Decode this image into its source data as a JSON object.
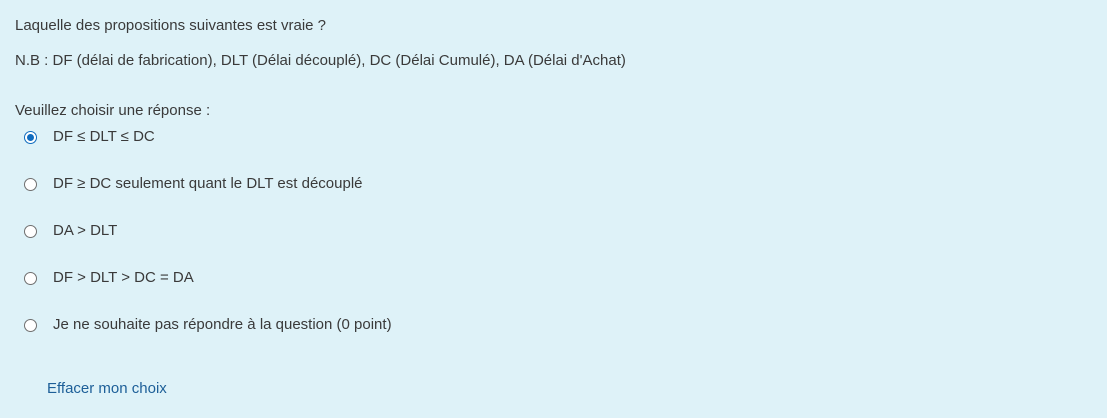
{
  "question": {
    "text": "Laquelle des propositions suivantes est vraie ?",
    "note": "N.B : DF (délai de fabrication), DLT (Délai découplé), DC (Délai Cumulé), DA (Délai d'Achat)",
    "prompt": "Veuillez choisir une réponse :"
  },
  "answers": [
    {
      "label": "DF ≤ DLT ≤ DC",
      "selected": true
    },
    {
      "label": "DF ≥ DC seulement quant le DLT est découplé",
      "selected": false
    },
    {
      "label": "DA > DLT",
      "selected": false
    },
    {
      "label": "DF > DLT > DC = DA",
      "selected": false
    },
    {
      "label": "Je ne souhaite pas répondre à la question (0 point)",
      "selected": false
    }
  ],
  "actions": {
    "clear_choice": "Effacer mon choix"
  },
  "colors": {
    "background": "#def2f8",
    "accent": "#0f6cbf",
    "link": "#1d5f98"
  }
}
